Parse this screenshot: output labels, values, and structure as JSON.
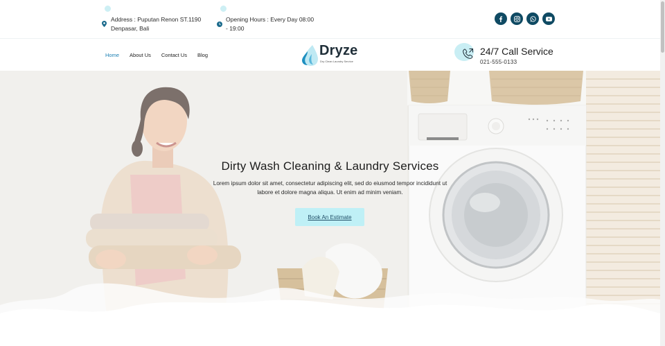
{
  "topbar": {
    "address": "Address : Puputan Renon ST.1190 Denpasar, Bali",
    "opening_hours": "Opening Hours : Every Day 08:00 - 19:00",
    "socials": [
      {
        "name": "facebook-icon",
        "glyph": "f"
      },
      {
        "name": "instagram-icon",
        "glyph": ""
      },
      {
        "name": "whatsapp-icon",
        "glyph": ""
      },
      {
        "name": "youtube-icon",
        "glyph": ""
      }
    ]
  },
  "nav": {
    "items": [
      {
        "label": "Home",
        "active": true
      },
      {
        "label": "About Us",
        "active": false
      },
      {
        "label": "Contact Us",
        "active": false
      },
      {
        "label": "Blog",
        "active": false
      }
    ]
  },
  "logo": {
    "name": "Dryze",
    "tagline": "Dry Clean Laundry Service"
  },
  "call": {
    "title": "24/7 Call Service",
    "number": "021-555-0133"
  },
  "hero": {
    "title": "Dirty Wash Cleaning & Laundry Services",
    "text": "Lorem ipsum dolor sit amet, consectetur adipiscing elit, sed do eiusmod tempor incididunt ut labore et dolore magna aliqua. Ut enim ad minim veniam.",
    "button": "Book An Estimate"
  },
  "colors": {
    "accent": "#1a7fb3",
    "social_bg": "#0f4a63",
    "button_bg": "#bff0f6",
    "light_cyan": "#c9eef4"
  }
}
